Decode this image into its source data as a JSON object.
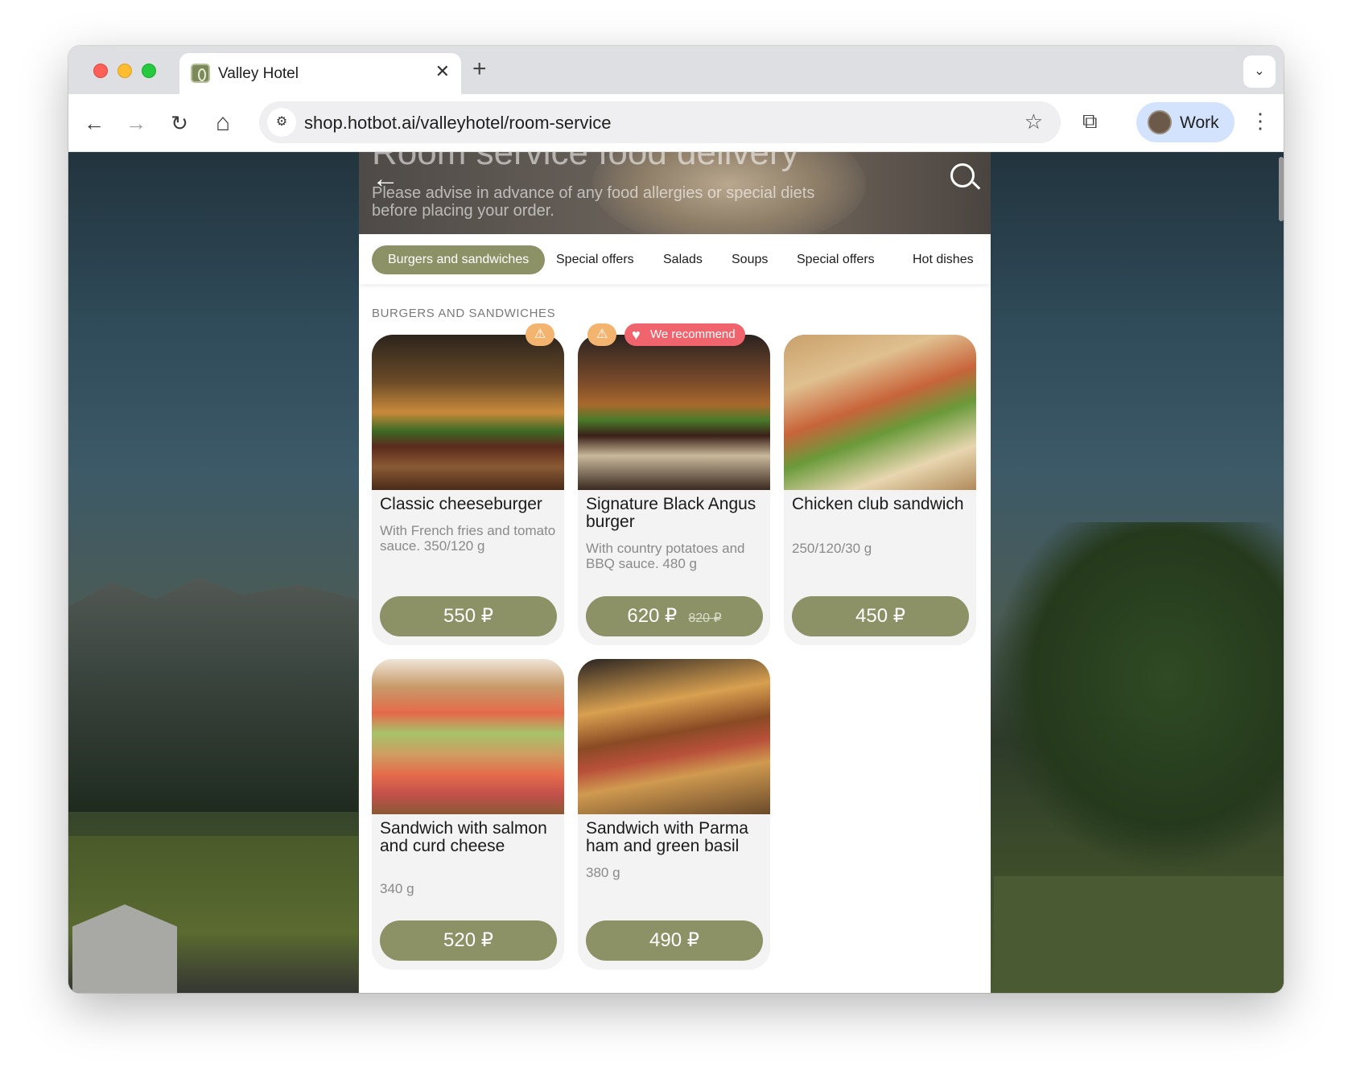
{
  "browser": {
    "tab_title": "Valley Hotel",
    "tab_close": "✕",
    "new_tab": "+",
    "tab_search_icon": "chevron-down-icon",
    "url": "shop.hotbot.ai/valleyhotel/room-service",
    "profile_label": "Work",
    "icons": {
      "back": "←",
      "forward": "→",
      "reload": "↻",
      "home": "⌂",
      "site_info": "⚙",
      "bookmark": "☆",
      "extensions": "⧉",
      "menu": "⋮",
      "tab_search": "⌄"
    }
  },
  "hero": {
    "title": "Room service food delivery",
    "back_icon": "←",
    "note": "Please advise in advance of any food allergies or special diets before placing your order."
  },
  "categories": [
    {
      "label": "Burgers and sandwiches",
      "active": true
    },
    {
      "label": "Special offers",
      "active": false
    },
    {
      "label": "Salads",
      "active": false
    },
    {
      "label": "Soups",
      "active": false
    },
    {
      "label": "Special offers",
      "active": false
    },
    {
      "label": "Hot dishes",
      "active": false
    }
  ],
  "section_heading": "BURGERS AND SANDWICHES",
  "products": [
    {
      "name": "Classic cheeseburger",
      "description": "With French fries and tomato sauce. 350/120 g",
      "price": "550 ₽",
      "badges": [
        "spicy-icon"
      ]
    },
    {
      "name": "Signature Black Angus burger",
      "description": "With country potatoes and BBQ sauce. 480 g",
      "price": "620 ₽",
      "old_price": "820 ₽",
      "badges": [
        "spicy-icon",
        "recommend"
      ],
      "recommend_label": "We recommend"
    },
    {
      "name": "Chicken club sandwich",
      "description": "250/120/30 g",
      "price": "450 ₽",
      "badges": []
    },
    {
      "name": "Sandwich with salmon and curd cheese",
      "description": "340 g",
      "price": "520 ₽",
      "badges": []
    },
    {
      "name": "Sandwich with Parma ham and green basil",
      "description": "380 g",
      "price": "490 ₽",
      "badges": []
    }
  ],
  "badge_glyph": "⚠",
  "heart_glyph": "♥",
  "colors": {
    "accent": "#8c9266",
    "recommend_badge": "#f0646e",
    "spicy_badge": "#f2b46f"
  }
}
